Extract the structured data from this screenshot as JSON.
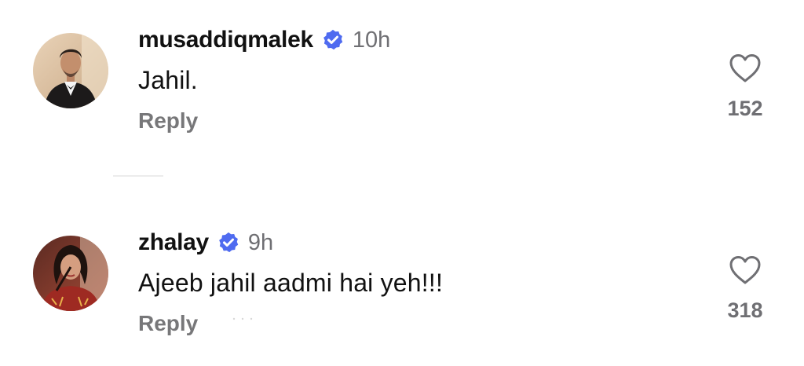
{
  "comments": [
    {
      "username": "musaddiqmalek",
      "verified_icon": "verified-badge-icon",
      "time": "10h",
      "text": "Jahil.",
      "reply_label": "Reply",
      "like_icon": "heart-outline-icon",
      "like_count": "152"
    },
    {
      "username": "zhalay",
      "verified_icon": "verified-badge-icon",
      "time": "9h",
      "text": "Ajeeb jahil aadmi hai yeh!!!",
      "reply_label": "Reply",
      "like_icon": "heart-outline-icon",
      "like_count": "318"
    }
  ],
  "colors": {
    "verified": "#4f6bf0",
    "secondary_text": "#6f6f73",
    "reply_text": "#777779",
    "divider": "#ececec"
  }
}
